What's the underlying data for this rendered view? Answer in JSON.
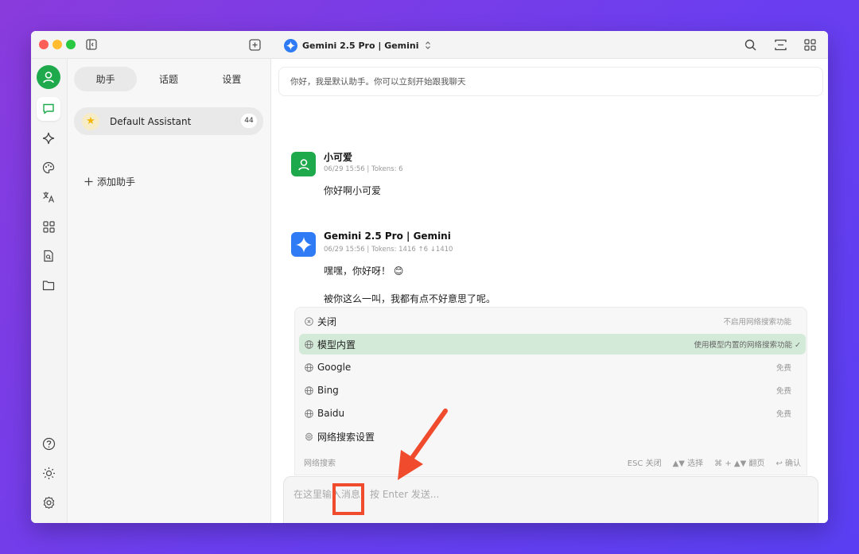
{
  "titlebar": {
    "model_title": "Gemini 2.5 Pro | Gemini"
  },
  "panel": {
    "tabs": [
      {
        "label": "助手",
        "active": true
      },
      {
        "label": "话题",
        "active": false
      },
      {
        "label": "设置",
        "active": false
      }
    ],
    "assistant": {
      "name": "Default Assistant",
      "count": "44"
    },
    "add_assistant": "添加助手"
  },
  "main": {
    "greeting": "你好，我是默认助手。你可以立刻开始跟我聊天",
    "messages": [
      {
        "name": "小可爱",
        "meta": "06/29 15:56  |  Tokens: 6",
        "lines": [
          "你好啊小可爱"
        ]
      },
      {
        "name": "Gemini 2.5 Pro | Gemini",
        "meta": "06/29 15:56  |  Tokens: 1416 ↑6 ↓1410",
        "lines": [
          "嘿嘿，你好呀！ 😊",
          "被你这么一叫，我都有点不好意思了呢。"
        ]
      }
    ],
    "search_menu": {
      "options": [
        {
          "label": "关闭",
          "desc": "不启用网络搜索功能",
          "icon": "close-circle-icon"
        },
        {
          "label": "模型内置",
          "desc": "使用模型内置的网络搜索功能 ✓",
          "icon": "globe-icon",
          "selected": true
        },
        {
          "label": "Google",
          "desc": "免费",
          "icon": "globe-icon"
        },
        {
          "label": "Bing",
          "desc": "免费",
          "icon": "globe-icon"
        },
        {
          "label": "Baidu",
          "desc": "免费",
          "icon": "globe-icon"
        },
        {
          "label": "网络搜索设置",
          "desc": "",
          "icon": "gear-icon"
        }
      ],
      "footer_title": "网络搜索",
      "footer_hints": [
        "ESC 关闭",
        "▲▼ 选择",
        "⌘ + ▲▼ 翻页",
        "↩ 确认"
      ]
    },
    "input": {
      "placeholder": "在这里输入消息，按 Enter 发送..."
    }
  },
  "colors": {
    "accent_green": "#1eaa4c",
    "gemini_blue": "#2f7bf5",
    "selected_row": "#d4ead8",
    "annotation_red": "#f04b2c"
  }
}
